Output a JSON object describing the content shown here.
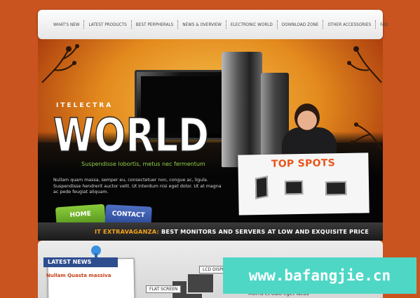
{
  "nav": {
    "items": [
      "WHAT'S NEW",
      "LATEST PRODUCTS",
      "BEST PERPHERALS",
      "NEWS & OVERVIEW",
      "ELECTRONIC WORLD",
      "DOWNLOAD ZONE",
      "OTHER ACCESSORIES",
      "FAQ"
    ]
  },
  "hero": {
    "brand_small": "ITELECTRA",
    "brand_big": "WORLD",
    "tagline": "Suspendisse lobortis, metus nec fermentum",
    "lorem": "Nullam quam massa, semper eu, consectetuer non, congue ac, ligula. Suspendisse hendrerit auctor velit. Ut interdum nisi eget dolor. Ut at magna ac pede feugiat aliquam.",
    "top_spots": "TOP SPOTS",
    "home_button": "HOME",
    "contact_button": "CONTACT"
  },
  "strip": {
    "accent": "IT EXTRAVAGANZA:",
    "text": " BEST MONITORS AND SERVERS AT LOW AND EXQUISITE PRICE"
  },
  "lower": {
    "news_title": "LATEST NEWS",
    "news_item": "Nullam Quasta massiva",
    "chip_lcd": "LCD DISPL",
    "chip_flat": "FLAT SCREEN",
    "partial_text": "Morris et odio eget lacus"
  },
  "watermark": "www.bafangjie.cn",
  "colors": {
    "background": "#c9541f",
    "accent_orange": "#e8561b",
    "tagline_green": "#8fd14a",
    "news_blue": "#2e4d8f",
    "watermark": "#4fd7c6"
  }
}
